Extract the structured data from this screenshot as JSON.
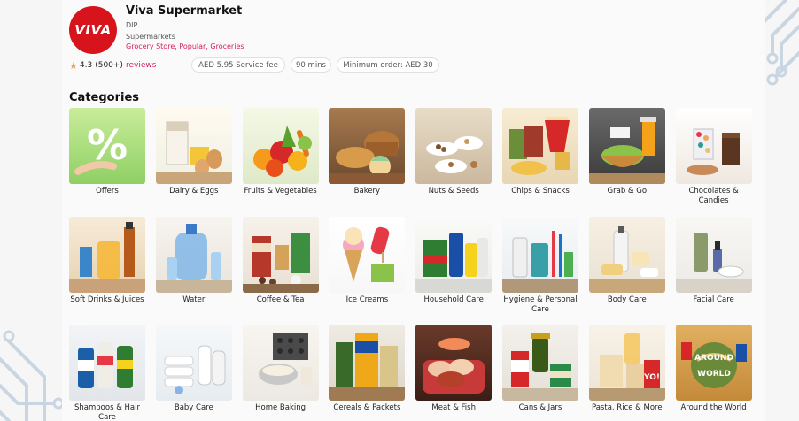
{
  "store": {
    "logo_text": "VIVA",
    "name": "Viva Supermarket",
    "subtitle1": "DIP",
    "subtitle2": "Supermarkets",
    "tags": "Grocery Store, Popular, Groceries"
  },
  "rating": {
    "value": "4.3",
    "count": "(500+)",
    "reviews_label": "reviews"
  },
  "info": {
    "service_fee": "AED 5.95 Service fee",
    "delivery_time": "90 mins",
    "minimum_order": "Minimum order: AED 30"
  },
  "section_title": "Categories",
  "colors": {
    "brand_red": "#d7141c",
    "accent_pink": "#d81b60",
    "star": "#f2a53c"
  },
  "categories": [
    {
      "label": "Offers",
      "icon": "percent-icon"
    },
    {
      "label": "Dairy & Eggs",
      "icon": "dairy-icon"
    },
    {
      "label": "Fruits & Vegetables",
      "icon": "fruits-icon"
    },
    {
      "label": "Bakery",
      "icon": "bread-icon"
    },
    {
      "label": "Nuts & Seeds",
      "icon": "nuts-icon"
    },
    {
      "label": "Chips & Snacks",
      "icon": "chips-icon"
    },
    {
      "label": "Grab & Go",
      "icon": "bowl-icon"
    },
    {
      "label": "Chocolates & Candies",
      "icon": "candy-icon"
    },
    {
      "label": "Soft Drinks & Juices",
      "icon": "drink-icon"
    },
    {
      "label": "Water",
      "icon": "water-icon"
    },
    {
      "label": "Coffee & Tea",
      "icon": "coffee-icon"
    },
    {
      "label": "Ice Creams",
      "icon": "icecream-icon"
    },
    {
      "label": "Household Care",
      "icon": "detergent-icon"
    },
    {
      "label": "Hygiene & Personal Care",
      "icon": "hygiene-icon"
    },
    {
      "label": "Body Care",
      "icon": "lotion-icon"
    },
    {
      "label": "Facial Care",
      "icon": "serum-icon"
    },
    {
      "label": "Shampoos & Hair Care",
      "icon": "shampoo-icon"
    },
    {
      "label": "Baby Care",
      "icon": "baby-bottle-icon"
    },
    {
      "label": "Home Baking",
      "icon": "baking-icon"
    },
    {
      "label": "Cereals & Packets",
      "icon": "cereal-icon"
    },
    {
      "label": "Meat & Fish",
      "icon": "meat-icon"
    },
    {
      "label": "Cans & Jars",
      "icon": "can-icon"
    },
    {
      "label": "Pasta, Rice & More",
      "icon": "pasta-icon"
    },
    {
      "label": "Around the World",
      "icon": "globe-icon"
    }
  ]
}
